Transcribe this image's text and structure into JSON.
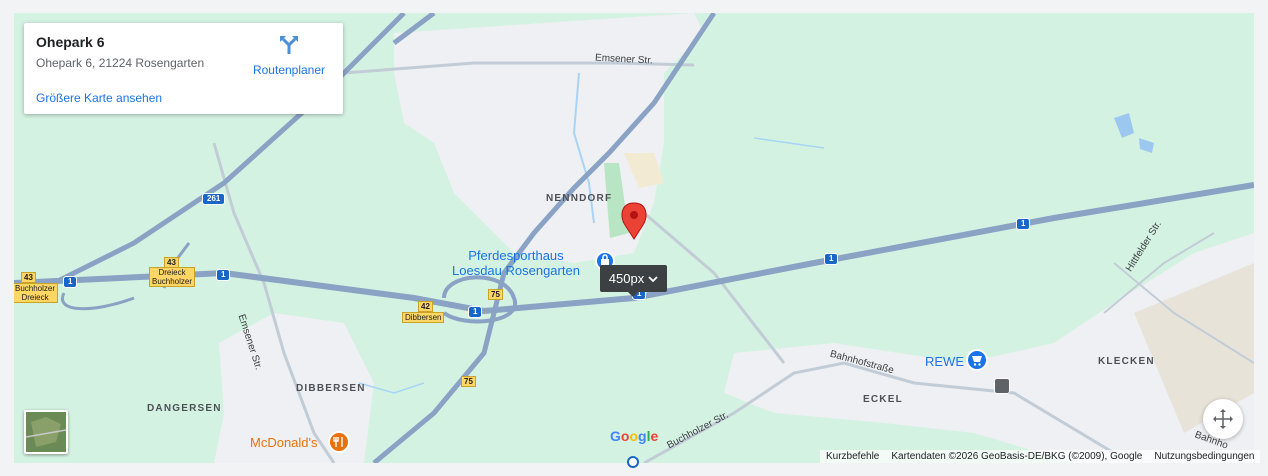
{
  "card": {
    "title": "Ohepark 6",
    "address": "Ohepark 6, 21224 Rosengarten",
    "route_label": "Routenplaner",
    "bigger_map_label": "Größere Karte ansehen"
  },
  "map": {
    "places": {
      "nenndorf": "NENNDORF",
      "dibbersen": "DIBBERSEN",
      "dangersen": "DANGERSEN",
      "eckel": "ECKEL",
      "klecken": "KLECKEN"
    },
    "streets": {
      "emsener_top": "Emsener Str.",
      "emsener_left": "Emsener Str.",
      "bahnhofstrasse": "Bahnhofstraße",
      "buchholzer": "Buchholzer Str.",
      "hittfelder": "Hittfelder Str.",
      "bahnho_partial": "Bahnho"
    },
    "pois": {
      "pferdesport_line1": "Pferdesporthaus",
      "pferdesport_line2": "Loesdau Rosengarten",
      "rewe": "REWE",
      "mcdonalds": "McDonald's"
    },
    "shields": {
      "a1": "1",
      "a261": "261",
      "b75": "75",
      "exit43": "43",
      "exit42": "42",
      "dreieck_line1": "Dreieck",
      "dreieck_line2": "Buchholzer",
      "buchholzer_left_line1": "Buchholzer",
      "buchholzer_left_line2": "Dreieck",
      "dibbersen_exit": "Dibbersen"
    }
  },
  "tooltip": {
    "label": "450px"
  },
  "footer": {
    "shortcuts": "Kurzbefehle",
    "attribution": "Kartendaten ©2026 GeoBasis-DE/BKG (©2009), Google",
    "terms": "Nutzungsbedingungen"
  },
  "logo": "Google",
  "colors": {
    "land": "#d4f2e2",
    "urban": "#eef0f3",
    "motorway": "#8aa2c4",
    "accent": "#1a73e8",
    "marker": "#ea4335"
  }
}
